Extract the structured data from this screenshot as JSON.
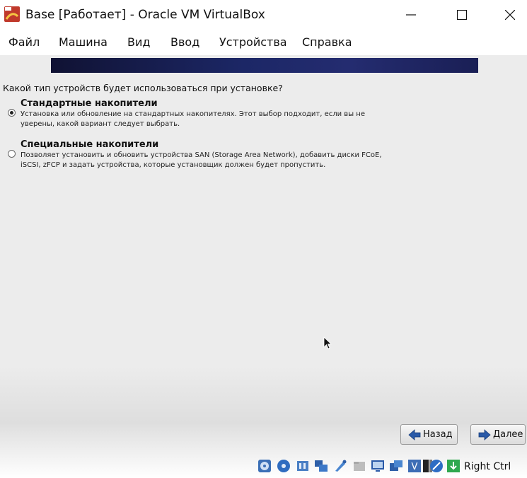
{
  "window": {
    "title": "Base [Работает] - Oracle VM VirtualBox"
  },
  "menu": {
    "items": [
      "Файл",
      "Машина",
      "Вид",
      "Ввод",
      "Устройства",
      "Справка"
    ]
  },
  "installer": {
    "question": "Какой тип устройств будет использоваться при установке?",
    "options": [
      {
        "title": "Стандартные накопители",
        "desc_line1": "Установка или обновление на стандартных накопителях. Этот выбор подходит, если вы не",
        "desc_line2": "уверены, какой вариант следует выбрать.",
        "selected": true
      },
      {
        "title": "Специальные накопители",
        "desc_line1": "Позволяет установить и обновить устройства SAN (Storage Area Network), добавить диски FCoE,",
        "desc_line2": "iSCSI, zFCP и задать устройства, которые установщик должен будет пропустить.",
        "selected": false
      }
    ],
    "back_label": "Назад",
    "next_label": "Далее"
  },
  "statusbar": {
    "icons": [
      "optical-drive-icon",
      "floppy-icon",
      "audio-icon",
      "network-icon",
      "usb-icon",
      "shared-folder-icon",
      "display-icon",
      "mouse-capture-icon",
      "virtualization-icon",
      "cpu-icon",
      "record-icon",
      "download-icon"
    ],
    "host_key": "Right Ctrl"
  },
  "colors": {
    "banner": "#1c2766",
    "arrow_blue": "#2a5aa8"
  }
}
